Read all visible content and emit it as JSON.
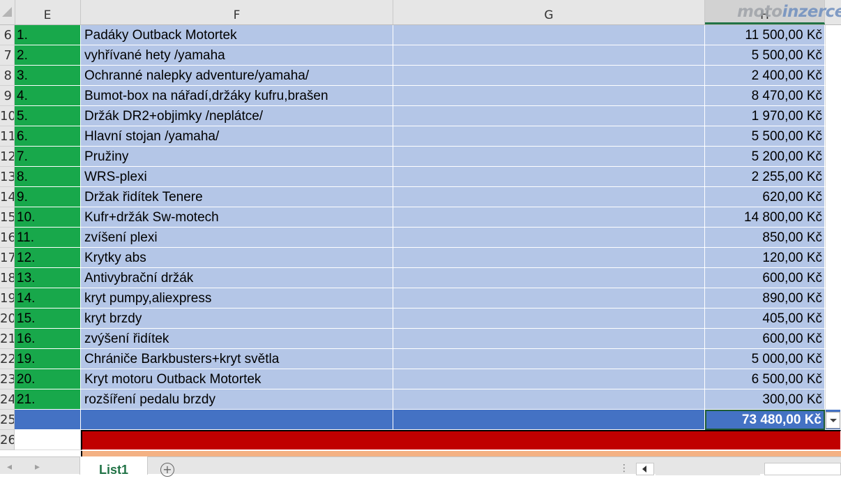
{
  "watermark": {
    "part1": "moto",
    "part2": "inzerce"
  },
  "columns": {
    "e": "E",
    "f": "F",
    "g": "G",
    "h": "H"
  },
  "rows": [
    {
      "rn": "6",
      "num": "1.",
      "item": "Padáky Outback Motortek",
      "price": "11 500,00 Kč"
    },
    {
      "rn": "7",
      "num": "2.",
      "item": "vyhřívané hety /yamaha",
      "price": "5 500,00 Kč"
    },
    {
      "rn": "8",
      "num": "3.",
      "item": "Ochranné nalepky adventure/yamaha/",
      "price": "2 400,00 Kč"
    },
    {
      "rn": "9",
      "num": "4.",
      "item": "Bumot-box na nářadí,držáky kufru,brašen",
      "price": "8 470,00 Kč"
    },
    {
      "rn": "10",
      "num": "5.",
      "item": "Držák DR2+objimky  /neplátce/",
      "price": "1 970,00 Kč"
    },
    {
      "rn": "11",
      "num": "6.",
      "item": "Hlavní stojan /yamaha/",
      "price": "5 500,00 Kč"
    },
    {
      "rn": "12",
      "num": "7.",
      "item": "Pružiny",
      "price": "5 200,00 Kč"
    },
    {
      "rn": "13",
      "num": "8.",
      "item": "WRS-plexi",
      "price": "2 255,00 Kč"
    },
    {
      "rn": "14",
      "num": "9.",
      "item": "Držak řidítek Tenere",
      "price": "620,00 Kč"
    },
    {
      "rn": "15",
      "num": "10.",
      "item": "Kufr+držák Sw-motech",
      "price": "14 800,00 Kč"
    },
    {
      "rn": "16",
      "num": "11.",
      "item": "zvíšení plexi",
      "price": "850,00 Kč"
    },
    {
      "rn": "17",
      "num": "12.",
      "item": "Krytky abs",
      "price": "120,00 Kč"
    },
    {
      "rn": "18",
      "num": "13.",
      "item": "Antivybrační držák",
      "price": "600,00 Kč"
    },
    {
      "rn": "19",
      "num": "14.",
      "item": "kryt pumpy,aliexpress",
      "price": "890,00 Kč"
    },
    {
      "rn": "20",
      "num": "15.",
      "item": "kryt brzdy",
      "price": "405,00 Kč"
    },
    {
      "rn": "21",
      "num": "16.",
      "item": "zvýšení řidítek",
      "price": "600,00 Kč"
    },
    {
      "rn": "22",
      "num": "19.",
      "item": "Chrániče Barkbusters+kryt světla",
      "price": "5 000,00 Kč"
    },
    {
      "rn": "23",
      "num": "20.",
      "item": "Kryt motoru Outback Motortek",
      "price": "6 500,00 Kč"
    },
    {
      "rn": "24",
      "num": "21.",
      "item": "rozšíření pedalu brzdy",
      "price": "300,00 Kč"
    }
  ],
  "total": {
    "rn": "25",
    "value": "73 480,00 Kč"
  },
  "red_row": {
    "rn": "26"
  },
  "sheet_tab": {
    "label": "List1"
  },
  "colors": {
    "green": "#18a84b",
    "light_blue": "#b4c6e7",
    "total_blue": "#4472c4",
    "red": "#c00000",
    "salmon": "#f4b183"
  }
}
